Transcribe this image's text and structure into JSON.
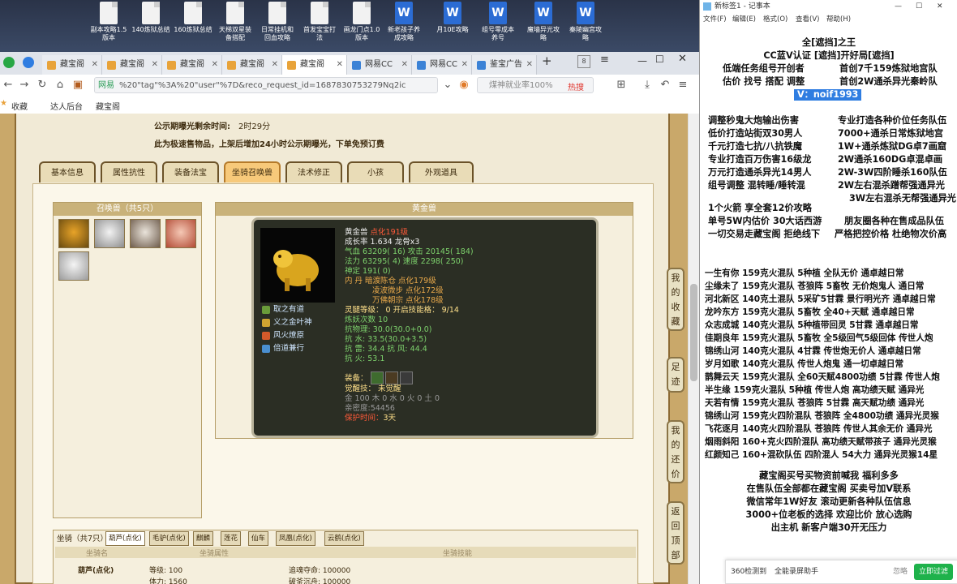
{
  "desktop": {
    "icons": [
      {
        "label": "副本攻略1.5\n版本",
        "type": "doc"
      },
      {
        "label": "140炼狱总结",
        "type": "doc"
      },
      {
        "label": "160炼狱总结",
        "type": "doc"
      },
      {
        "label": "天梯双星装\n备搭配",
        "type": "doc"
      },
      {
        "label": "日常挂机和\n回血攻略",
        "type": "doc"
      },
      {
        "label": "首发宝宝打\n法",
        "type": "doc"
      },
      {
        "label": "画龙门点1.0\n版本",
        "type": "doc"
      },
      {
        "label": "新老孩子养\n成攻略",
        "type": "word"
      },
      {
        "label": "月10E攻略",
        "type": "word"
      },
      {
        "label": "组号零成本\n养号",
        "type": "word"
      },
      {
        "label": "魔墙异光攻\n略",
        "type": "word"
      },
      {
        "label": "秦陵幽宫攻\n略",
        "type": "word"
      }
    ]
  },
  "browser": {
    "tabs": [
      "藏宝阁",
      "藏宝阁",
      "藏宝阁",
      "藏宝阁",
      "藏宝阁",
      "网易CC",
      "网易CC",
      "鉴宝广告"
    ],
    "tab_count": "8",
    "url": "%20\"tag\"%3A%20\"user\"%7D&reco_request_id=1687830753279Nq2ic",
    "site_label": "网易",
    "search_placeholder": "煤神就业率100%",
    "hot_label": "热搜",
    "fav_items": [
      "收藏",
      "达人后台",
      "藏宝阁"
    ]
  },
  "game": {
    "notice_label": "公示期曝光剩余时间:",
    "notice_time": "2时29分",
    "notice_text": "此为极速售物品，上架后增加24小时公示期曝光，下单免预订费",
    "tabs": [
      "基本信息",
      "属性抗性",
      "装备法宝",
      "坐骑召唤兽",
      "法术修正",
      "小孩",
      "外观道具"
    ],
    "summon_header": "召唤兽（共5只）",
    "detail_header": "黄金兽",
    "pet": {
      "name": "黄金兽",
      "level": "点化191级",
      "growth": "成长率 1.634 龙骨x3",
      "hp": "气血 63209(  16) 攻击 20145(  184)",
      "mp": "法力 63295(  4) 速度 2298(  250)",
      "ward": "神定 191(  0)",
      "inner": "内    丹 暗渡陈仓 点化179级",
      "inner2": "凌波微步 点化172级",
      "inner3": "万佛朝宗 点化178级",
      "spirit": "灵腿等级：  0  开启技能格：  9/14",
      "refine": "炼妖次数 10",
      "resist": "抗物理: 30.0(30.0+0.0)",
      "res_water": "抗    水: 33.5(30.0+3.5)",
      "res_thunder": "抗    雷: 34.4 抗    风: 44.4",
      "res_fire": "抗    火: 53.1",
      "equip_label": "装备：",
      "awake": "觉醒技：   未觉醒",
      "elements": "金 100 木 0 水 0 火 0 土 0",
      "intimacy": "亲密度:54456",
      "protect": "保护时间：",
      "protect_val": "3天",
      "skills": [
        "取之有道",
        "义之金叶神",
        "风火燎原",
        "倍道兼行"
      ]
    },
    "mounts": {
      "title": "坐骑（共7只）",
      "tabs": [
        "葫芦(点化)",
        "毛驴(点化)",
        "麒麟",
        "莲花",
        "仙车",
        "凤凰(点化)",
        "云鹤(点化)"
      ],
      "col1": "坐骑名",
      "col2": "坐骑属性",
      "col3": "坐骑技能",
      "row_name": "葫芦(点化)",
      "row_level": "等级: 100",
      "row_vit": "体力: 1560",
      "row_skill1": "追魂夺命: 100000",
      "row_skill2": "破釜沉舟: 100000"
    },
    "side_buttons": [
      "我的收藏",
      "足迹",
      "我的还价",
      "返回顶部"
    ]
  },
  "notepad": {
    "title": "新标签1 - 记事本",
    "menu": [
      "文件(F)",
      "编辑(E)",
      "格式(O)",
      "查看(V)",
      "帮助(H)"
    ],
    "lines_top": [
      "全[遮挡]之王",
      "CC蓝V认证 [遮挡]开好局[遮挡]"
    ],
    "header_left": [
      "低端任务组号开创者",
      "估价 找号 搭配 调整"
    ],
    "header_right": [
      "首创7千159炼狱地宫队",
      "首创2W通杀异光秦岭队"
    ],
    "vid": "V：noif1993",
    "left_col": [
      "调整秒鬼大炮输出伤害",
      "低价打造站街双30男人",
      "千元打造七抗/八抗铁魔",
      "专业打造百万伤害16级龙",
      "万元打造通杀异光14男人",
      "组号调整 混转睡/睡转混"
    ],
    "right_col": [
      "专业打造各种价位任务队伍",
      "7000+通杀日常炼狱地宫",
      "1W+通杀炼狱DG卓7画窟",
      "2W通杀160DG卓混卓画",
      "2W-3W四阶睡杀160队伍",
      "2W左右混杀蹭帮强通异光",
      "3W左右混杀无帮强通异光"
    ],
    "mid_lines": [
      "1个火箭 享全套12价攻略",
      "单号5W内估价 30大话西游",
      "一切交易走藏宝阁 拒绝线下"
    ],
    "mid_right": [
      "朋友圈各种在售成品队伍",
      "严格把控价格 杜绝物次价高"
    ],
    "teams": [
      "一生有你 159克火混队 5种植 全队无价 通卓越日常",
      "尘缘未了 159克火混队 苍狼阵 5畜牧 无价炮鬼人 通日常",
      "河北新区 140克土混队 5采矿5甘霖 景行明光齐 通卓越日常",
      "龙吟东方 159克火混队 5畜牧 全40+天赋 通卓越日常",
      "众志成城 140克火混队 5种植带回灵 5甘霖 通卓越日常",
      "佳期良年 159克火混队 5畜牧 全5级回气5级回体 传世人炮",
      "锦绣山河 140克火混队 4甘霖 传世炮无价人 通卓越日常",
      "岁月如歌 140克火混队 传世人炮鬼 通一切卓越日常",
      "鹊舞云天 159克火混队 全60天赋4800功绩 5甘霖 传世人炮",
      "半生缘   159克火混队 5种植 传世人炮 高功绩天赋 通异光",
      "天若有情 159克火混队 苍狼阵 5甘霖 高天赋功绩 通异光",
      "锦绣山河 159克火四阶混队 苍狼阵 全4800功绩 通异光灵猴",
      "飞花逐月 140克火四阶混队 苍狼阵 传世人其余无价 通异光",
      "烟雨斜阳 160+克火四阶混队 高功绩天赋带孩子 通异光灵猴",
      "红颜知己 160+混砍队伍 四阶混人 54大力 通异光灵猴14星"
    ],
    "footer": [
      "藏宝阁买号买物资前喊我 福利多多",
      "在售队伍全部都在藏宝阁 买卖号加V联系",
      "微信常年1W好友 滚动更新各种队伍信息",
      "3000+位老板的选择 欢迎比价 放心选购",
      "出主机 新客户端30开无压力"
    ]
  },
  "popup": {
    "label": "360检测到",
    "text": "全能录屏助手",
    "ignore": "忽略",
    "action": "立即过滤"
  }
}
